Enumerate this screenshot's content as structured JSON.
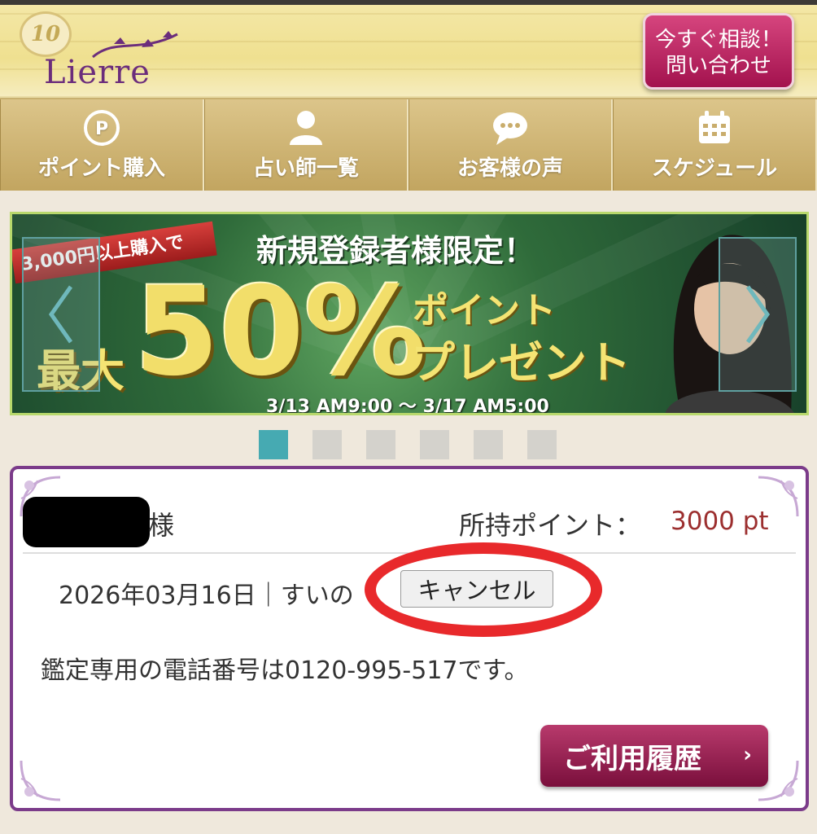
{
  "header": {
    "logo_text": "Lierre",
    "logo_emblem": "10",
    "contact_line1": "今すぐ相談！",
    "contact_line2": "問い合わせ"
  },
  "nav": {
    "items": [
      {
        "label": "ポイント購入",
        "icon": "point-coin-icon"
      },
      {
        "label": "占い師一覧",
        "icon": "person-icon"
      },
      {
        "label": "お客様の声",
        "icon": "chat-bubble-icon"
      },
      {
        "label": "スケジュール",
        "icon": "calendar-icon"
      }
    ]
  },
  "banner": {
    "ribbon": "3,000円以上購入で",
    "heading": "新規登録者様限定！",
    "max": "最大",
    "big": "50%",
    "point_line1": "ポイント",
    "point_line2": "プレゼント",
    "date": "3/13 AM9:00 ～ 3/17 AM5:00"
  },
  "carousel": {
    "dots": 6,
    "active_index": 0
  },
  "card": {
    "sama": "様",
    "points_label": "所持ポイント：",
    "points_value": "3000 pt",
    "booking_text": "2026年03月16日｜すいの",
    "cancel_label": "キャンセル",
    "phone_text": "鑑定専用の電話番号は0120-995-517です。",
    "history_label": "ご利用履歴",
    "history_chevron": "›"
  },
  "colors": {
    "accent_purple": "#7b3b8a",
    "points_red": "#9c2f2f",
    "annotation_red": "#e8292b",
    "active_dot": "#46aab2"
  }
}
